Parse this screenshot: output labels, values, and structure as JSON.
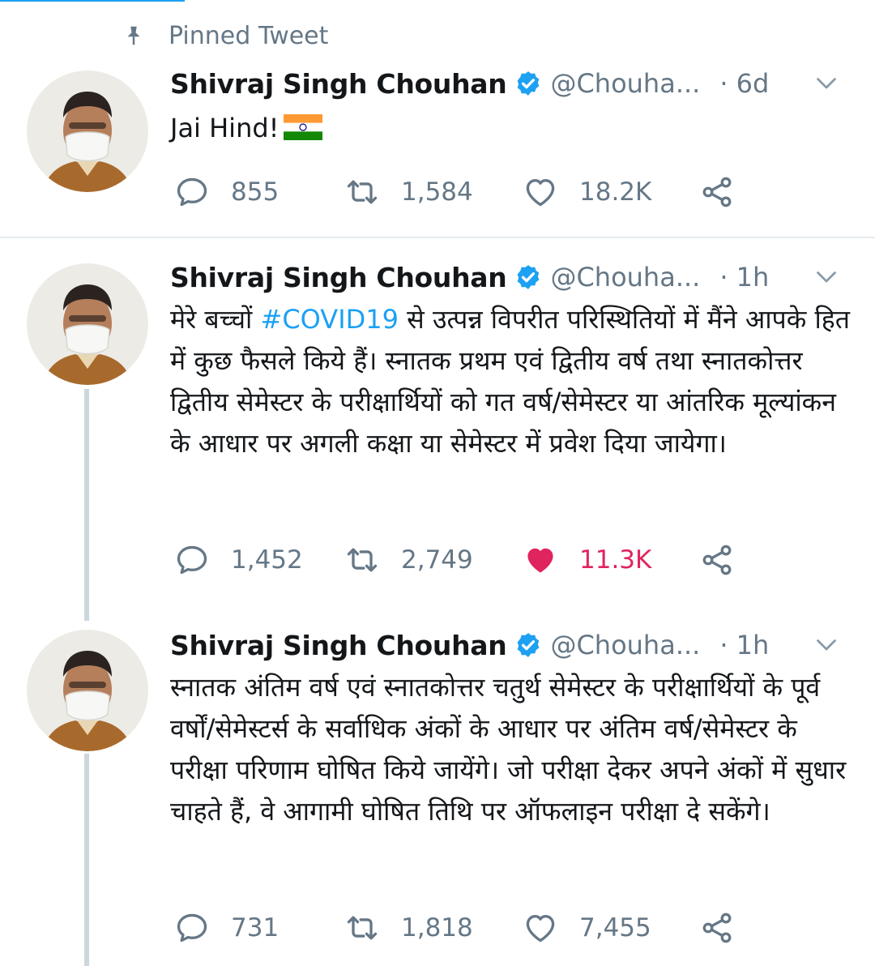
{
  "pinned_label": "Pinned Tweet",
  "colors": {
    "accent": "#1da1f2",
    "muted": "#657786",
    "like": "#e0245e",
    "divider": "#e6ecf0"
  },
  "tweets": [
    {
      "name": "Shivraj Singh Chouhan",
      "handle": "@Chouha...",
      "time": "· 6d",
      "text": "Jai Hind!",
      "replies": "855",
      "retweets": "1,584",
      "likes": "18.2K",
      "liked": false
    },
    {
      "name": "Shivraj Singh Chouhan",
      "handle": "@Chouha...",
      "time": "· 1h",
      "text_pre": "मेरे बच्चों ",
      "hashtag": "#COVID19",
      "text_post": " से उत्पन्न विपरीत परिस्थितियों में मैंने आपके हित में कुछ फैसले किये हैं। स्नातक प्रथम एवं द्वितीय वर्ष तथा स्नातकोत्तर द्वितीय सेमेस्टर के परीक्षार्थियों को गत वर्ष/सेमेस्टर या आंतरिक मूल्यांकन के आधार पर अगली कक्षा या सेमेस्टर में प्रवेश दिया जायेगा।",
      "replies": "1,452",
      "retweets": "2,749",
      "likes": "11.3K",
      "liked": true
    },
    {
      "name": "Shivraj Singh Chouhan",
      "handle": "@Chouha...",
      "time": "· 1h",
      "text": "स्नातक अंतिम वर्ष एवं स्नातकोत्तर चतुर्थ सेमेस्टर के परीक्षार्थियों के पूर्व वर्षों/सेमेस्टर्स के सर्वाधिक अंकों के आधार पर अंतिम वर्ष/सेमेस्टर के परीक्षा परिणाम घोषित किये जायेंगे। जो परीक्षा देकर अपने अंकों में सुधार चाहते हैं, वे आगामी घोषित तिथि पर ऑफलाइन परीक्षा दे सकेंगे।",
      "replies": "731",
      "retweets": "1,818",
      "likes": "7,455",
      "liked": false
    }
  ]
}
